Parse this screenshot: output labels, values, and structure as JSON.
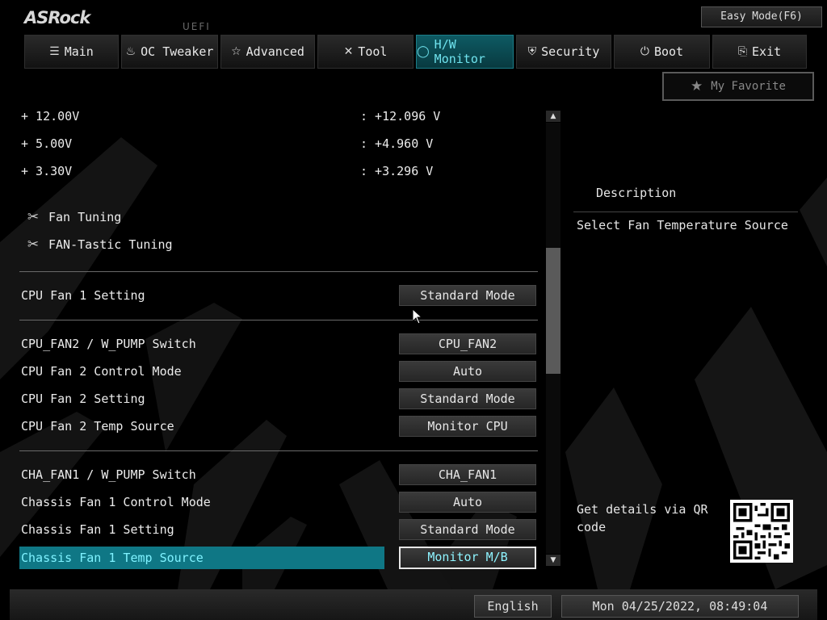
{
  "header": {
    "logo": "ASRock",
    "uefi": "UEFI",
    "easy_mode": "Easy Mode(F6)"
  },
  "tabs": [
    {
      "label": "Main",
      "icon": "list-icon"
    },
    {
      "label": "OC Tweaker",
      "icon": "rocket-icon"
    },
    {
      "label": "Advanced",
      "icon": "star-tool-icon"
    },
    {
      "label": "Tool",
      "icon": "wrench-icon"
    },
    {
      "label": "H/W Monitor",
      "icon": "monitor-icon",
      "active": true
    },
    {
      "label": "Security",
      "icon": "shield-icon"
    },
    {
      "label": "Boot",
      "icon": "power-icon"
    },
    {
      "label": "Exit",
      "icon": "exit-icon"
    }
  ],
  "favorite": {
    "label": "My Favorite"
  },
  "voltages": [
    {
      "label": "+ 12.00V",
      "value": ": +12.096 V"
    },
    {
      "label": "+ 5.00V",
      "value": ": +4.960 V"
    },
    {
      "label": "+ 3.30V",
      "value": ": +3.296 V"
    }
  ],
  "tools": [
    {
      "label": "Fan Tuning"
    },
    {
      "label": "FAN-Tastic Tuning"
    }
  ],
  "settings": {
    "cpu_fan1_setting": {
      "label": "CPU Fan 1 Setting",
      "value": "Standard Mode"
    },
    "cpu_fan2_switch": {
      "label": "CPU_FAN2 / W_PUMP Switch",
      "value": "CPU_FAN2"
    },
    "cpu_fan2_control": {
      "label": "CPU Fan 2 Control Mode",
      "value": "Auto"
    },
    "cpu_fan2_setting": {
      "label": "CPU Fan 2 Setting",
      "value": "Standard Mode"
    },
    "cpu_fan2_temp": {
      "label": "CPU Fan 2 Temp Source",
      "value": "Monitor CPU"
    },
    "cha_fan1_switch": {
      "label": "CHA_FAN1 / W_PUMP Switch",
      "value": "CHA_FAN1"
    },
    "cha_fan1_control": {
      "label": "Chassis Fan 1 Control Mode",
      "value": "Auto"
    },
    "cha_fan1_setting": {
      "label": "Chassis Fan 1 Setting",
      "value": "Standard Mode"
    },
    "cha_fan1_temp": {
      "label": "Chassis Fan 1 Temp Source",
      "value": "Monitor M/B"
    }
  },
  "description": {
    "title": "Description",
    "text": "Select Fan Temperature Source",
    "qr_text": "Get details via QR code"
  },
  "footer": {
    "language": "English",
    "datetime": "Mon 04/25/2022, 08:49:04"
  },
  "colors": {
    "accent": "#0f7785",
    "highlight_text": "#7ff2ff",
    "background": "#000000"
  }
}
